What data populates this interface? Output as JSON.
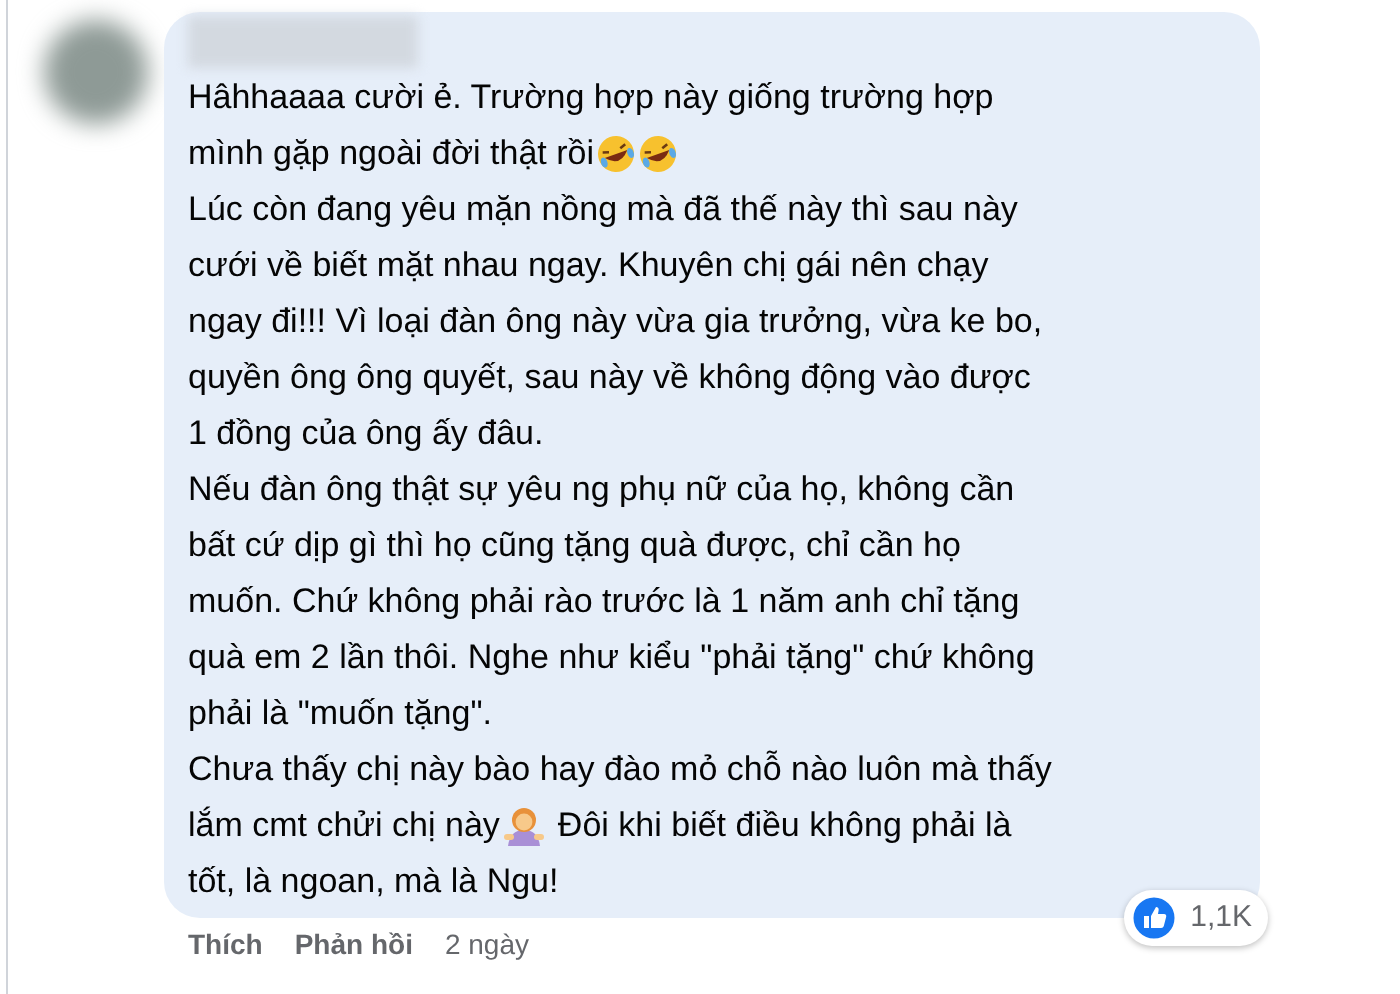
{
  "comment": {
    "lines": [
      {
        "parts": [
          {
            "kind": "text",
            "text": "Hâhhaaaa cười ẻ. Trường hợp này giống trường hợp"
          }
        ]
      },
      {
        "parts": [
          {
            "kind": "text",
            "text": "mình gặp ngoài đời thật rồi"
          },
          {
            "kind": "laugh-emoji"
          },
          {
            "kind": "laugh-emoji"
          }
        ]
      },
      {
        "parts": [
          {
            "kind": "text",
            "text": "Lúc còn đang yêu mặn nồng mà đã thế này thì sau này"
          }
        ]
      },
      {
        "parts": [
          {
            "kind": "text",
            "text": "cưới về biết mặt nhau ngay. Khuyên chị gái nên chạy"
          }
        ]
      },
      {
        "parts": [
          {
            "kind": "text",
            "text": "ngay đi!!! Vì loại đàn ông này vừa gia trưởng, vừa ke bo,"
          }
        ]
      },
      {
        "parts": [
          {
            "kind": "text",
            "text": "quyền ông ông quyết, sau này về không động vào được"
          }
        ]
      },
      {
        "parts": [
          {
            "kind": "text",
            "text": "1 đồng của ông ấy đâu."
          }
        ]
      },
      {
        "parts": [
          {
            "kind": "text",
            "text": "Nếu đàn ông thật sự yêu ng phụ nữ của họ, không cần"
          }
        ]
      },
      {
        "parts": [
          {
            "kind": "text",
            "text": "bất cứ dịp gì thì họ cũng tặng quà được, chỉ cần họ"
          }
        ]
      },
      {
        "parts": [
          {
            "kind": "text",
            "text": "muốn. Chứ không phải rào trước là 1 năm anh chỉ tặng"
          }
        ]
      },
      {
        "parts": [
          {
            "kind": "text",
            "text": "quà em 2 lần thôi. Nghe như kiểu \"phải tặng\" chứ không"
          }
        ]
      },
      {
        "parts": [
          {
            "kind": "text",
            "text": "phải là \"muốn tặng\"."
          }
        ]
      },
      {
        "parts": [
          {
            "kind": "text",
            "text": "Chưa thấy chị này bào hay đào mỏ chỗ nào luôn mà thấy"
          }
        ]
      },
      {
        "parts": [
          {
            "kind": "text",
            "text": "lắm cmt chửi chị này"
          },
          {
            "kind": "gesture-emoji"
          },
          {
            "kind": "text",
            "text": "Đôi khi biết điều không phải là"
          }
        ]
      },
      {
        "parts": [
          {
            "kind": "text",
            "text": "tốt, là ngoan, mà là Ngu!"
          }
        ]
      }
    ],
    "reaction_count": "1,1K",
    "actions": [
      {
        "label": "Thích",
        "kind": "link"
      },
      {
        "label": "Phản hồi",
        "kind": "link"
      },
      {
        "label": "2 ngày",
        "kind": "time"
      }
    ]
  }
}
